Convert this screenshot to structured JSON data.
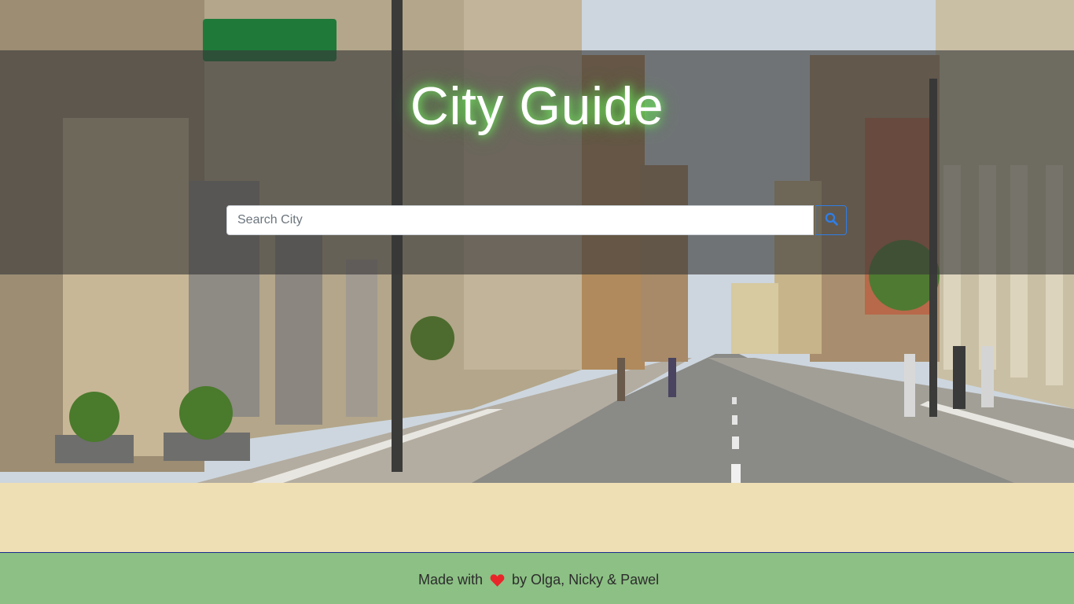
{
  "hero": {
    "title": "City Guide",
    "background": "street-photo"
  },
  "search": {
    "placeholder": "Search City",
    "value": "",
    "button_icon": "search-icon"
  },
  "footer": {
    "prefix": "Made with",
    "icon": "heart-icon",
    "suffix": "by Olga, Nicky & Pawel"
  },
  "colors": {
    "page_background": "#efdfb4",
    "footer_background": "#8cc084",
    "footer_border": "#1d2b8f",
    "title_glow": "#7dff64",
    "search_accent": "#2f7ee5",
    "heart": "#e8262a"
  }
}
